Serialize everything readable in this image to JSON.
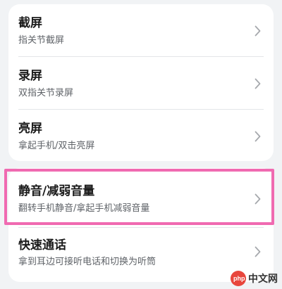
{
  "settings": {
    "items": [
      {
        "title": "截屏",
        "subtitle": "指关节截屏"
      },
      {
        "title": "录屏",
        "subtitle": "双指关节录屏"
      },
      {
        "title": "亮屏",
        "subtitle": "拿起手机/双击亮屏"
      },
      {
        "title": "静音/减弱音量",
        "subtitle": "翻转手机静音/拿起手机减弱音量"
      },
      {
        "title": "快速通话",
        "subtitle": "拿到耳边可接听电话和切换为听筒"
      }
    ]
  },
  "highlight": {
    "color": "#f06ab1"
  },
  "watermark": {
    "badge": "php",
    "text": "中文网"
  }
}
